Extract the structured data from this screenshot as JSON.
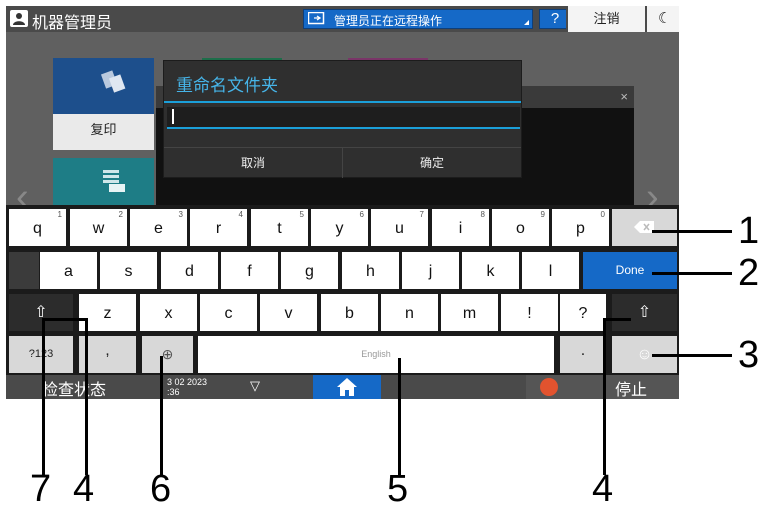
{
  "header": {
    "user_name": "机器管理员",
    "remote_status": "管理员正在远程操作",
    "help_label": "?",
    "logout_label": "注销",
    "energy_icon": "☾"
  },
  "home": {
    "copy_tile_label": "复印",
    "nav_prev": "‹",
    "nav_next": "›"
  },
  "background_window": {
    "close_label": "×"
  },
  "dialog": {
    "title": "重命名文件夹",
    "input_value": "",
    "cancel_label": "取消",
    "confirm_label": "确定"
  },
  "keyboard": {
    "row1": [
      {
        "label": "q",
        "hint": "1"
      },
      {
        "label": "w",
        "hint": "2"
      },
      {
        "label": "e",
        "hint": "3"
      },
      {
        "label": "r",
        "hint": "4"
      },
      {
        "label": "t",
        "hint": "5"
      },
      {
        "label": "y",
        "hint": "6"
      },
      {
        "label": "u",
        "hint": "7"
      },
      {
        "label": "i",
        "hint": "8"
      },
      {
        "label": "o",
        "hint": "9"
      },
      {
        "label": "p",
        "hint": "0"
      }
    ],
    "row2": [
      "a",
      "s",
      "d",
      "f",
      "g",
      "h",
      "j",
      "k",
      "l"
    ],
    "row3": [
      "z",
      "x",
      "c",
      "v",
      "b",
      "n",
      "m",
      "!",
      "?"
    ],
    "done_label": "Done",
    "shift_symbol": "⇧",
    "numbers_label": "?123",
    "comma_label": ",",
    "globe_symbol": "⊕",
    "space_label": "English",
    "period_label": ".",
    "emoji_symbol": "☺"
  },
  "footer": {
    "check_status_label": "检查状态",
    "date_line1": "3 02 2023",
    "date_line2": ":36",
    "stop_label": "停止"
  },
  "callouts": [
    "1",
    "2",
    "3",
    "4",
    "4",
    "5",
    "6",
    "7"
  ],
  "colors": {
    "accent_blue": "#1569c7",
    "dialog_title": "#46b4e8",
    "stop_red": "#e2532f"
  }
}
